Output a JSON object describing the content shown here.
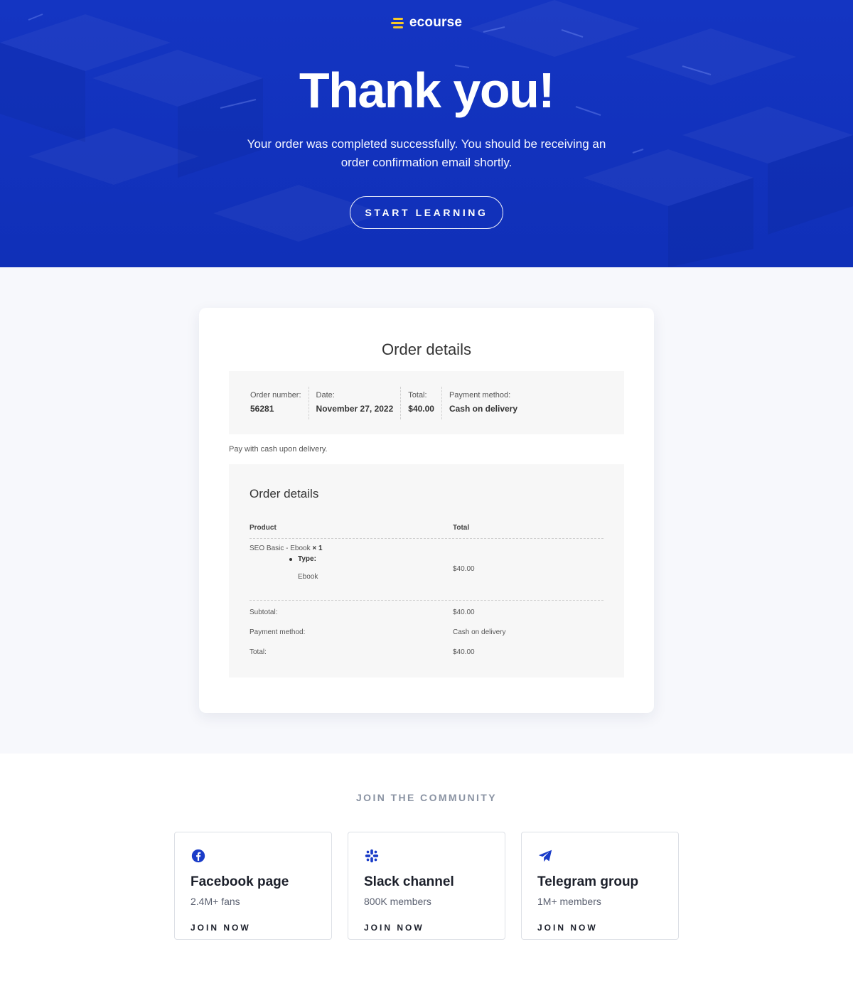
{
  "brand": {
    "name": "ecourse",
    "logo_icon": "ecourse-logo-icon",
    "accent": "#f7c928"
  },
  "hero": {
    "title": "Thank you!",
    "subtitle": "Your order was completed successfully. You should be receiving an order confirmation email shortly.",
    "cta_label": "START LEARNING",
    "background": "#1435c2"
  },
  "order": {
    "title": "Order details",
    "summary": [
      {
        "label": "Order number:",
        "value": "56281"
      },
      {
        "label": "Date:",
        "value": "November 27, 2022"
      },
      {
        "label": "Total:",
        "value": "$40.00"
      },
      {
        "label": "Payment method:",
        "value": "Cash on delivery"
      }
    ],
    "payment_note": "Pay with cash upon delivery.",
    "details": {
      "title": "Order details",
      "columns": [
        "Product",
        "Total"
      ],
      "item": {
        "name": "SEO Basic - Ebook",
        "quantity": "× 1",
        "meta_key": "Type:",
        "meta_value": "Ebook",
        "total": "$40.00"
      },
      "totals": [
        {
          "label": "Subtotal:",
          "value": "$40.00"
        },
        {
          "label": "Payment method:",
          "value": "Cash on delivery"
        },
        {
          "label": "Total:",
          "value": "$40.00"
        }
      ]
    }
  },
  "community": {
    "heading": "JOIN THE COMMUNITY",
    "cards": [
      {
        "icon": "facebook-icon",
        "title": "Facebook page",
        "stat": "2.4M+ fans",
        "cta": "JOIN NOW"
      },
      {
        "icon": "slack-icon",
        "title": "Slack channel",
        "stat": "800K members",
        "cta": "JOIN NOW"
      },
      {
        "icon": "telegram-icon",
        "title": "Telegram group",
        "stat": "1M+ members",
        "cta": "JOIN NOW"
      }
    ],
    "icon_color": "#1a3cc8"
  }
}
